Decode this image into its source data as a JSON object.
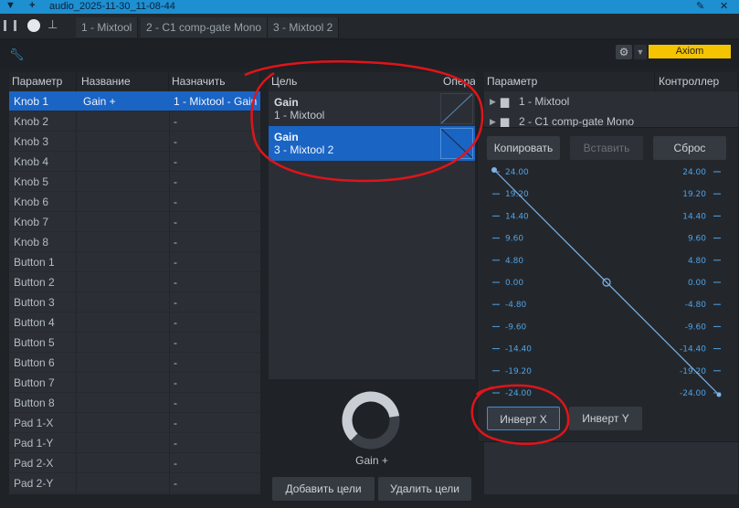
{
  "window": {
    "title": "audio_2025-11-30_11-08-44"
  },
  "tabs": [
    {
      "label": "1 - Mixtool"
    },
    {
      "label": "2 - C1 comp-gate Mono"
    },
    {
      "label": "3 - Mixtool 2"
    }
  ],
  "device": {
    "name": "Axiom"
  },
  "left": {
    "headers": {
      "param": "Параметр",
      "name": "Название",
      "assign": "Назначить"
    },
    "rows": [
      {
        "param": "Knob 1",
        "name": "Gain +",
        "assign": "1 - Mixtool - Gain",
        "selected": true
      },
      {
        "param": "Knob 2",
        "name": "",
        "assign": "-"
      },
      {
        "param": "Knob 3",
        "name": "",
        "assign": "-"
      },
      {
        "param": "Knob 4",
        "name": "",
        "assign": "-"
      },
      {
        "param": "Knob 5",
        "name": "",
        "assign": "-"
      },
      {
        "param": "Knob 6",
        "name": "",
        "assign": "-"
      },
      {
        "param": "Knob 7",
        "name": "",
        "assign": "-"
      },
      {
        "param": "Knob 8",
        "name": "",
        "assign": "-"
      },
      {
        "param": "Button 1",
        "name": "",
        "assign": "-"
      },
      {
        "param": "Button 2",
        "name": "",
        "assign": "-"
      },
      {
        "param": "Button 3",
        "name": "",
        "assign": "-"
      },
      {
        "param": "Button 4",
        "name": "",
        "assign": "-"
      },
      {
        "param": "Button 5",
        "name": "",
        "assign": "-"
      },
      {
        "param": "Button 6",
        "name": "",
        "assign": "-"
      },
      {
        "param": "Button 7",
        "name": "",
        "assign": "-"
      },
      {
        "param": "Button 8",
        "name": "",
        "assign": "-"
      },
      {
        "param": "Pad 1-X",
        "name": "",
        "assign": "-"
      },
      {
        "param": "Pad 1-Y",
        "name": "",
        "assign": "-"
      },
      {
        "param": "Pad 2-X",
        "name": "",
        "assign": "-"
      },
      {
        "param": "Pad 2-Y",
        "name": "",
        "assign": "-"
      }
    ]
  },
  "middle": {
    "headers": {
      "target": "Цель",
      "op": "Опера"
    },
    "targets": [
      {
        "param": "Gain",
        "device": "1 - Mixtool",
        "selected": false
      },
      {
        "param": "Gain",
        "device": "3 - Mixtool 2",
        "selected": true
      }
    ],
    "knob_label": "Gain +",
    "knob_level": 0.8,
    "add_button": "Добавить цели",
    "remove_button": "Удалить цели"
  },
  "right": {
    "headers": {
      "param": "Параметр",
      "controller": "Контроллер"
    },
    "tree": [
      {
        "label": "1 - Mixtool"
      },
      {
        "label": "2 - C1 comp-gate Mono"
      }
    ]
  },
  "curve_popup": {
    "copy": "Копировать",
    "paste": "Вставить",
    "reset": "Сброс",
    "ticks": [
      "24.00",
      "19.20",
      "14.40",
      "9.60",
      "4.80",
      "0.00",
      "-4.80",
      "-9.60",
      "-14.40",
      "-19.20",
      "-24.00"
    ],
    "invert_x": "Инверт X",
    "invert_y": "Инверт Y",
    "accent": "#4fa1e4"
  }
}
